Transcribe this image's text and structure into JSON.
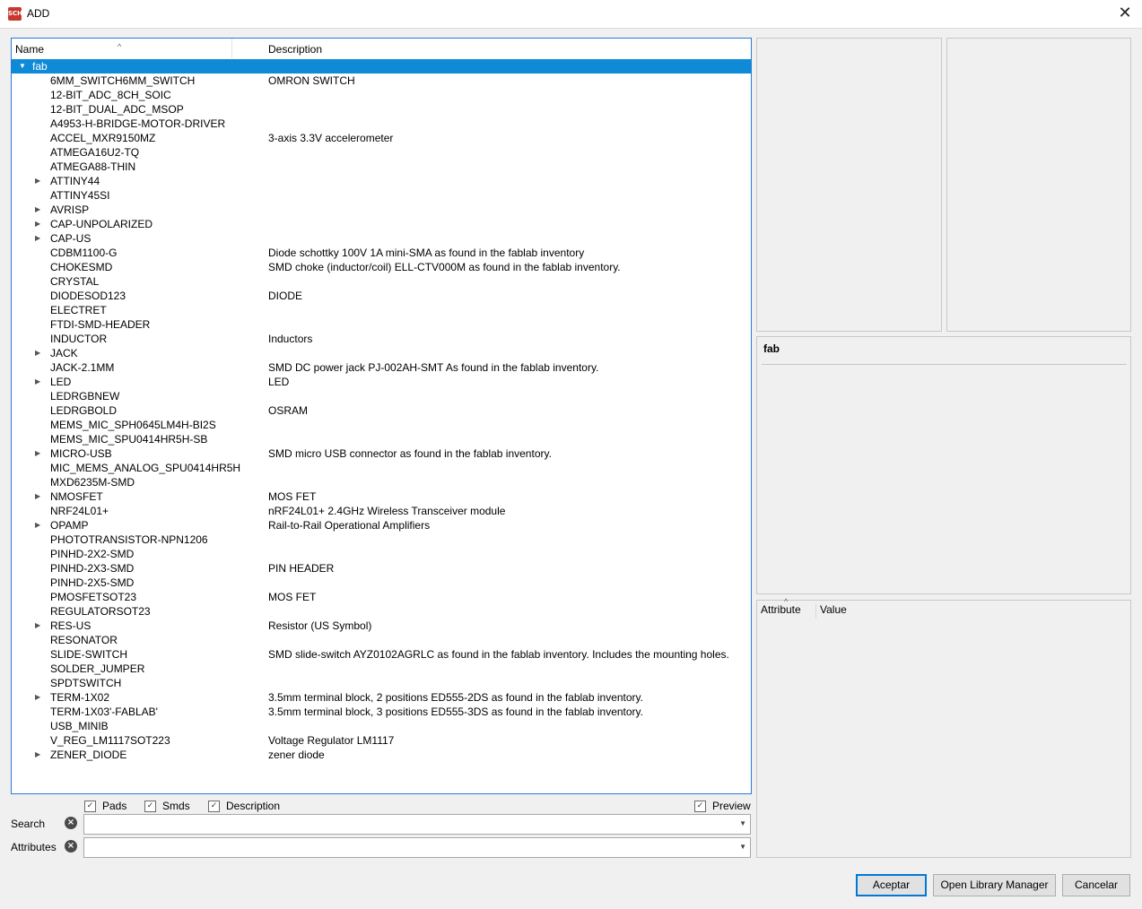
{
  "window": {
    "title": "ADD",
    "icon_text": "SCH"
  },
  "tree": {
    "col_name": "Name",
    "col_description": "Description",
    "root": {
      "name": "fab",
      "expanded": true
    },
    "items": [
      {
        "name": "6MM_SWITCH6MM_SWITCH",
        "desc": "OMRON SWITCH",
        "expandable": false
      },
      {
        "name": "12-BIT_ADC_8CH_SOIC",
        "desc": "",
        "expandable": false
      },
      {
        "name": "12-BIT_DUAL_ADC_MSOP",
        "desc": "",
        "expandable": false
      },
      {
        "name": "A4953-H-BRIDGE-MOTOR-DRIVER",
        "desc": "",
        "expandable": false
      },
      {
        "name": "ACCEL_MXR9150MZ",
        "desc": "3-axis 3.3V accelerometer",
        "expandable": false
      },
      {
        "name": "ATMEGA16U2-TQ",
        "desc": "",
        "expandable": false
      },
      {
        "name": "ATMEGA88-THIN",
        "desc": "",
        "expandable": false
      },
      {
        "name": "ATTINY44",
        "desc": "",
        "expandable": true
      },
      {
        "name": "ATTINY45SI",
        "desc": "",
        "expandable": false
      },
      {
        "name": "AVRISP",
        "desc": "",
        "expandable": true
      },
      {
        "name": "CAP-UNPOLARIZED",
        "desc": "",
        "expandable": true
      },
      {
        "name": "CAP-US",
        "desc": "",
        "expandable": true
      },
      {
        "name": "CDBM1100-G",
        "desc": "Diode schottky 100V 1A mini-SMA as found in the fablab inventory",
        "expandable": false
      },
      {
        "name": "CHOKESMD",
        "desc": "SMD choke (inductor/coil) ELL-CTV000M as found in the fablab inventory.",
        "expandable": false
      },
      {
        "name": "CRYSTAL",
        "desc": "",
        "expandable": false
      },
      {
        "name": "DIODESOD123",
        "desc": "DIODE",
        "expandable": false
      },
      {
        "name": "ELECTRET",
        "desc": "",
        "expandable": false
      },
      {
        "name": "FTDI-SMD-HEADER",
        "desc": "",
        "expandable": false
      },
      {
        "name": "INDUCTOR",
        "desc": "Inductors",
        "expandable": false
      },
      {
        "name": "JACK",
        "desc": "",
        "expandable": true
      },
      {
        "name": "JACK-2.1MM",
        "desc": "SMD DC power jack PJ-002AH-SMT As found in the fablab inventory.",
        "expandable": false
      },
      {
        "name": "LED",
        "desc": "LED",
        "expandable": true
      },
      {
        "name": "LEDRGBNEW",
        "desc": "",
        "expandable": false
      },
      {
        "name": "LEDRGBOLD",
        "desc": "OSRAM",
        "expandable": false
      },
      {
        "name": "MEMS_MIC_SPH0645LM4H-BI2S",
        "desc": "",
        "expandable": false
      },
      {
        "name": "MEMS_MIC_SPU0414HR5H-SB",
        "desc": "",
        "expandable": false
      },
      {
        "name": "MICRO-USB",
        "desc": "SMD micro USB connector as found in the fablab inventory.",
        "expandable": true
      },
      {
        "name": "MIC_MEMS_ANALOG_SPU0414HR5H",
        "desc": "",
        "expandable": false
      },
      {
        "name": "MXD6235M-SMD",
        "desc": "",
        "expandable": false
      },
      {
        "name": "NMOSFET",
        "desc": "MOS FET",
        "expandable": true
      },
      {
        "name": "NRF24L01+",
        "desc": "nRF24L01+ 2.4GHz Wireless Transceiver module",
        "expandable": false
      },
      {
        "name": "OPAMP",
        "desc": "Rail-to-Rail Operational Amplifiers",
        "expandable": true
      },
      {
        "name": "PHOTOTRANSISTOR-NPN1206",
        "desc": "",
        "expandable": false
      },
      {
        "name": "PINHD-2X2-SMD",
        "desc": "",
        "expandable": false
      },
      {
        "name": "PINHD-2X3-SMD",
        "desc": "PIN HEADER",
        "expandable": false
      },
      {
        "name": "PINHD-2X5-SMD",
        "desc": "",
        "expandable": false
      },
      {
        "name": "PMOSFETSOT23",
        "desc": "MOS FET",
        "expandable": false
      },
      {
        "name": "REGULATORSOT23",
        "desc": "",
        "expandable": false
      },
      {
        "name": "RES-US",
        "desc": "Resistor (US Symbol)",
        "expandable": true
      },
      {
        "name": "RESONATOR",
        "desc": "",
        "expandable": false
      },
      {
        "name": "SLIDE-SWITCH",
        "desc": "SMD slide-switch AYZ0102AGRLC as found in the fablab inventory.  Includes the mounting holes.",
        "expandable": false
      },
      {
        "name": "SOLDER_JUMPER",
        "desc": "",
        "expandable": false
      },
      {
        "name": "SPDTSWITCH",
        "desc": "",
        "expandable": false
      },
      {
        "name": "TERM-1X02",
        "desc": "3.5mm terminal block, 2 positions ED555-2DS as found in the fablab inventory.",
        "expandable": true
      },
      {
        "name": "TERM-1X03'-FABLAB'",
        "desc": "3.5mm terminal block, 3 positions ED555-3DS as found in the fablab inventory.",
        "expandable": false
      },
      {
        "name": "USB_MINIB",
        "desc": "",
        "expandable": false
      },
      {
        "name": "V_REG_LM1117SOT223",
        "desc": "Voltage Regulator LM1117",
        "expandable": false
      },
      {
        "name": "ZENER_DIODE",
        "desc": "zener diode",
        "expandable": true
      }
    ]
  },
  "info": {
    "title": "fab"
  },
  "attributes": {
    "col_attribute": "Attribute",
    "col_value": "Value"
  },
  "options": {
    "pads": "Pads",
    "smds": "Smds",
    "description": "Description",
    "preview": "Preview"
  },
  "search": {
    "label": "Search",
    "value": ""
  },
  "attr_filter": {
    "label": "Attributes",
    "value": ""
  },
  "buttons": {
    "ok": "Aceptar",
    "library_manager": "Open Library Manager",
    "cancel": "Cancelar"
  },
  "colors": {
    "selection": "#0f8ad6",
    "focus_border": "#2b79d7"
  },
  "icons": {
    "expand": "triangle-right-icon",
    "collapse": "triangle-down-icon",
    "clear": "clear-x-icon"
  }
}
